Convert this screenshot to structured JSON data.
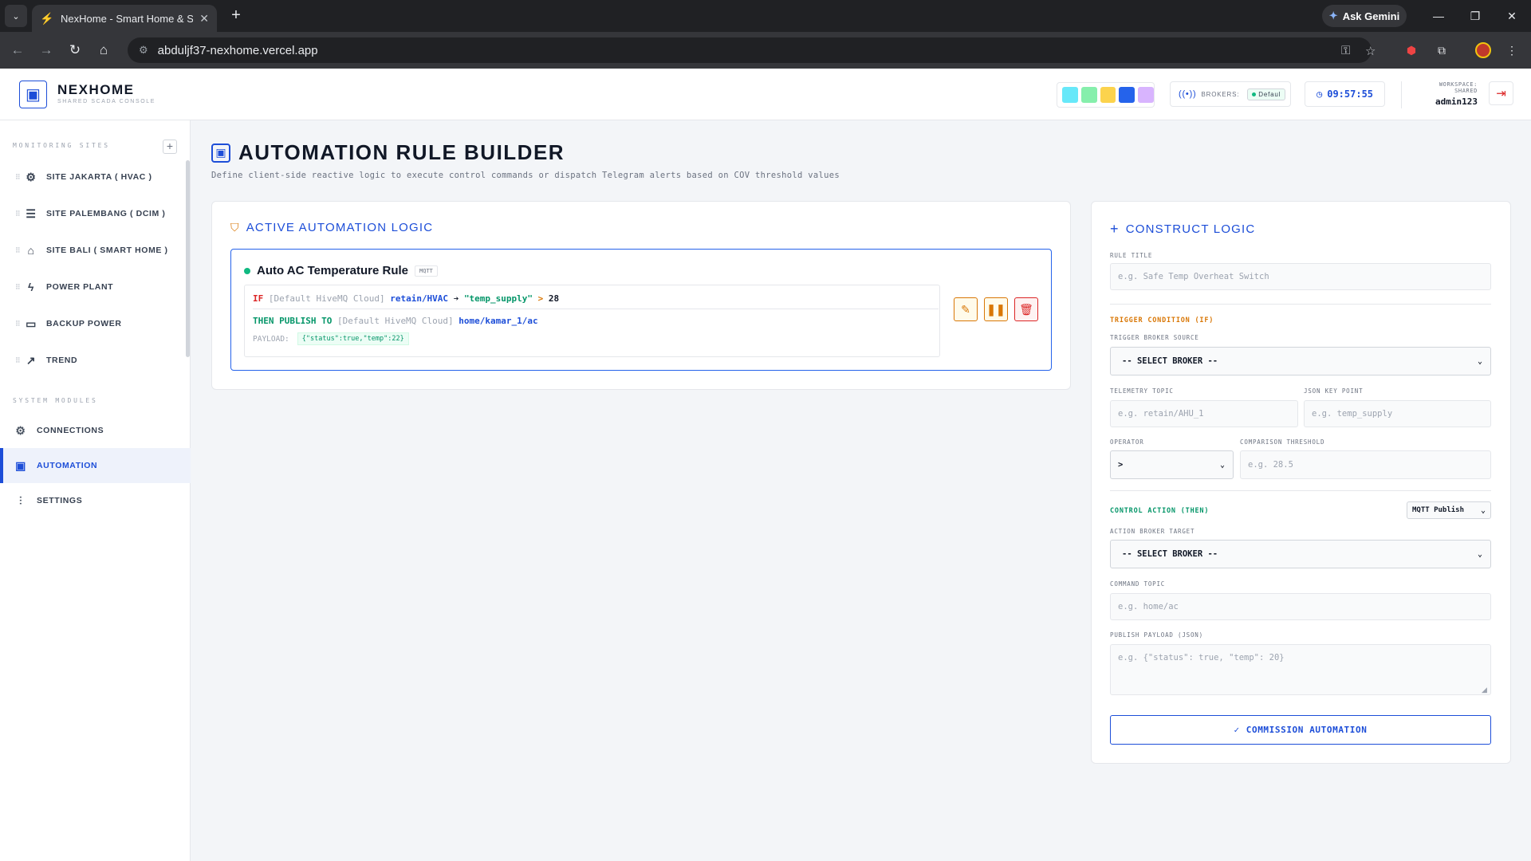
{
  "browser": {
    "tab_title": "NexHome - Smart Home & SCADA",
    "url": "abduljf37-nexhome.vercel.app",
    "gemini_label": "Ask Gemini"
  },
  "header": {
    "brand": "NEXHOME",
    "brand_sub": "SHARED SCADA CONSOLE",
    "theme_colors": [
      "#67e8f9",
      "#86efac",
      "#fcd34d",
      "#2563eb",
      "#d8b4fe"
    ],
    "brokers_label": "BROKERS:",
    "broker_chip": "Defaul",
    "clock": "09:57:55",
    "workspace_label": "WORKSPACE: SHARED",
    "workspace_user": "admin123"
  },
  "sidebar": {
    "sites_label": "MONITORING SITES",
    "sites": [
      {
        "label": "SITE JAKARTA ( HVAC )",
        "icon": "cpu-icon"
      },
      {
        "label": "SITE PALEMBANG ( DCIM )",
        "icon": "server-icon"
      },
      {
        "label": "SITE BALI ( SMART HOME )",
        "icon": "home-icon"
      },
      {
        "label": "POWER PLANT",
        "icon": "bolt-icon"
      },
      {
        "label": "BACKUP POWER",
        "icon": "battery-icon"
      },
      {
        "label": "TREND",
        "icon": "trend-icon"
      }
    ],
    "modules_label": "SYSTEM MODULES",
    "modules": [
      {
        "label": "CONNECTIONS",
        "icon": "gear-icon"
      },
      {
        "label": "AUTOMATION",
        "icon": "chip-icon"
      },
      {
        "label": "SETTINGS",
        "icon": "sliders-icon"
      }
    ]
  },
  "main": {
    "title": "AUTOMATION RULE BUILDER",
    "subtitle": "Define client-side reactive logic to execute control commands or dispatch Telegram alerts based on COV threshold values"
  },
  "active_logic": {
    "title": "ACTIVE AUTOMATION LOGIC",
    "rule": {
      "name": "Auto AC Temperature Rule",
      "tag": "MQTT",
      "if_kw": "IF",
      "if_broker": "[Default HiveMQ Cloud]",
      "if_topic": "retain/HVAC",
      "arrow": "➔",
      "if_key": "\"temp_supply\"",
      "operator": ">",
      "threshold": "28",
      "then_kw": "THEN PUBLISH TO",
      "then_broker": "[Default HiveMQ Cloud]",
      "then_topic": "home/kamar_1/ac",
      "payload_label": "PAYLOAD:",
      "payload_value": "{\"status\":true,\"temp\":22}"
    }
  },
  "construct": {
    "title": "CONSTRUCT LOGIC",
    "rule_title_label": "RULE TITLE",
    "rule_title_placeholder": "e.g. Safe Temp Overheat Switch",
    "trigger_label": "TRIGGER CONDITION (IF)",
    "trigger_broker_label": "TRIGGER BROKER SOURCE",
    "trigger_broker_value": "-- SELECT BROKER --",
    "telemetry_topic_label": "TELEMETRY TOPIC",
    "telemetry_topic_placeholder": "e.g. retain/AHU_1",
    "json_key_label": "JSON KEY POINT",
    "json_key_placeholder": "e.g. temp_supply",
    "operator_label": "OPERATOR",
    "operator_value": ">",
    "threshold_label": "COMPARISON THRESHOLD",
    "threshold_placeholder": "e.g. 28.5",
    "action_label": "CONTROL ACTION (THEN)",
    "action_type": "MQTT Publish",
    "action_broker_label": "ACTION BROKER TARGET",
    "action_broker_value": "-- SELECT BROKER --",
    "command_topic_label": "COMMAND TOPIC",
    "command_topic_placeholder": "e.g. home/ac",
    "payload_label": "PUBLISH PAYLOAD (JSON)",
    "payload_placeholder": "e.g. {\"status\": true, \"temp\": 20}",
    "submit_label": "COMMISSION AUTOMATION"
  }
}
